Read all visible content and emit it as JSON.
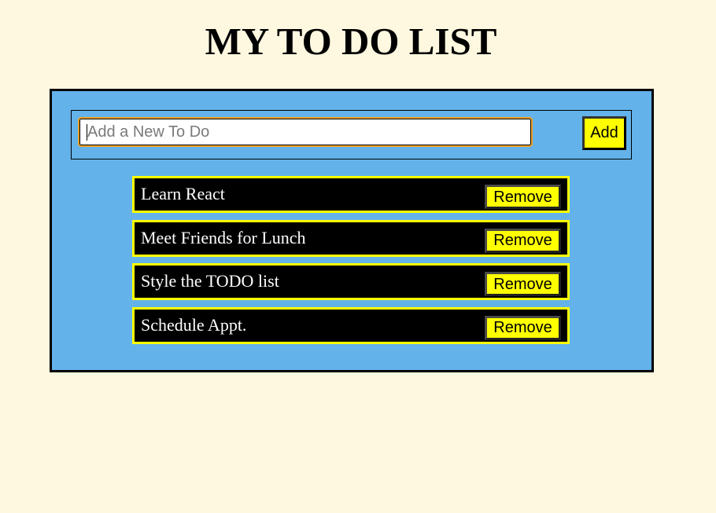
{
  "header": {
    "title": "MY TO DO LIST"
  },
  "add_form": {
    "placeholder": "Add a New To Do",
    "value": "",
    "add_label": "Add"
  },
  "todos": [
    {
      "text": "Learn React",
      "remove_label": "Remove"
    },
    {
      "text": "Meet Friends for Lunch",
      "remove_label": "Remove"
    },
    {
      "text": "Style the TODO list",
      "remove_label": "Remove"
    },
    {
      "text": "Schedule Appt.",
      "remove_label": "Remove"
    }
  ],
  "colors": {
    "page_background": "#fff8e0",
    "panel_background": "#63b2ea",
    "accent_yellow": "#ffff00",
    "item_background": "#000000",
    "input_focus_border": "#f0a020"
  }
}
